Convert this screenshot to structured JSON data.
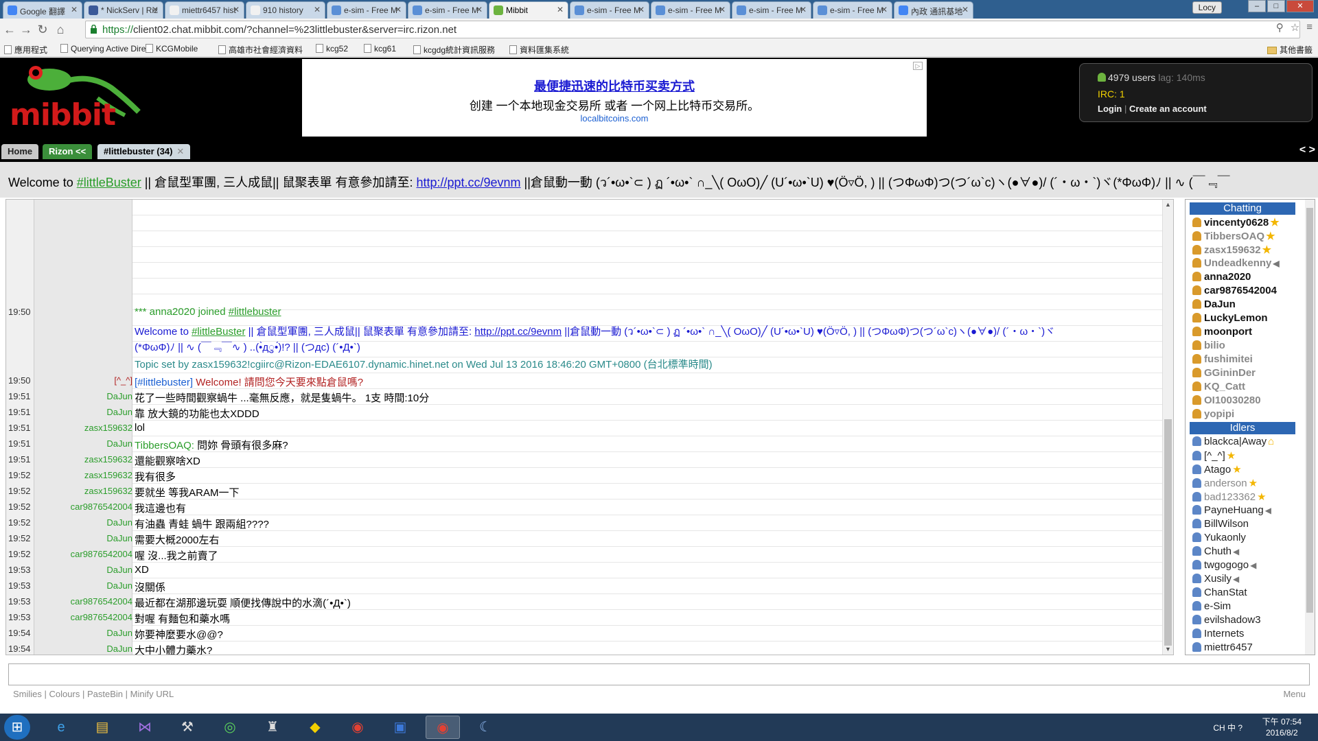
{
  "browser": {
    "tabs": [
      {
        "label": "Google 翻譯",
        "color": "#4285f4"
      },
      {
        "label": "* NickServ | Riz",
        "color": "#3b5998"
      },
      {
        "label": "miettr6457 hist",
        "color": "#f1f1f1"
      },
      {
        "label": "910 history",
        "color": "#f1f1f1"
      },
      {
        "label": "e-sim - Free M",
        "color": "#5a8fd6"
      },
      {
        "label": "e-sim - Free M",
        "color": "#5a8fd6"
      },
      {
        "label": "Mibbit",
        "color": "#6db33f"
      },
      {
        "label": "e-sim - Free M",
        "color": "#5a8fd6"
      },
      {
        "label": "e-sim - Free M",
        "color": "#5a8fd6"
      },
      {
        "label": "e-sim - Free M",
        "color": "#5a8fd6"
      },
      {
        "label": "e-sim - Free M",
        "color": "#5a8fd6"
      },
      {
        "label": "內政 通訊基地",
        "color": "#4285f4"
      }
    ],
    "profile": "Locy",
    "url_scheme": "https://",
    "url_rest": "client02.chat.mibbit.com/?channel=%23littlebuster&server=irc.rizon.net",
    "bookmarks": [
      {
        "label": "應用程式",
        "folder": false
      },
      {
        "label": "Querying Active Dire",
        "folder": false
      },
      {
        "label": "KCGMobile",
        "folder": false
      },
      {
        "label": "高雄市社會經濟資料",
        "folder": false
      },
      {
        "label": "kcg52",
        "folder": false
      },
      {
        "label": "kcg61",
        "folder": false
      },
      {
        "label": "kcgdg統計資訊服務",
        "folder": false
      },
      {
        "label": "資料匯集系統",
        "folder": false
      }
    ],
    "other_bookmarks": "其他書籤"
  },
  "mibbit": {
    "logo": "mibbit",
    "ad": {
      "title": "最便捷迅速的比特币买卖方式",
      "body": "创建 一个本地现金交易所 或者 一个网上比特币交易所。",
      "link": "localbitcoins.com"
    },
    "status": {
      "users": "4979 users",
      "lag": "lag: 140ms",
      "irc": "IRC: 1",
      "login": "Login",
      "sep": "|",
      "create": "Create an account"
    },
    "tabs": {
      "home": "Home",
      "server": "Rizon <<",
      "channel": "#littlebuster (34)",
      "arrows": "< >"
    },
    "topic": {
      "prefix": "Welcome to ",
      "channel_link": "#littleBuster",
      "mid": " || 倉鼠型軍團, 三人成鼠|| 鼠聚表單 有意參加請至: ",
      "url": "http://ppt.cc/9evnm",
      "tail": " ||倉鼠動一動 (ว´•ω•`⊂ ) ฏ ´•ω•` ∩_╲( OωO)╱ (U´•ω•`U) ♥(Ö▿Ö, ) || (つΦωΦ)つ(つ´ω`c)ヽ(●∀●)/ (´・ω・`)ヾ(*ΦωΦ)ﾉ || ∿ (￣﹃￣"
    },
    "system": {
      "join_time": "19:50",
      "join_text": "*** anna2020 joined ",
      "join_channel": "#littlebuster",
      "topic_line1_prefix": "Welcome to ",
      "topic_line1_channel": "#littleBuster",
      "topic_line1_mid": " || 倉鼠型軍團, 三人成鼠|| 鼠聚表單 有意參加請至: ",
      "topic_line1_url": "http://ppt.cc/9evnm",
      "topic_line1_tail": " ||倉鼠動一動 (ว´•ω•`⊂ ) ฏ ´•ω•` ∩_╲( OωO)╱ (U´•ω•`U) ♥(Ö▿Ö, ) || (つΦωΦ)つ(つ´ω`c)ヽ(●∀●)/ (´・ω・`)ヾ",
      "topic_line2": "(*ΦωΦ)ﾉ || ∿ (￣﹃￣∿ ) ..(•̀дु•́)!? || (つдc) (´•Д•`)",
      "set_by": "Topic set by zasx159632!cgiirc@Rizon-EDAE6107.dynamic.hinet.net on Wed Jul 13 2016 18:46:20 GMT+0800 (台北標準時間)"
    },
    "messages": [
      {
        "time": "19:50",
        "nick": "[^_^]",
        "op": true,
        "text": "Welcome! 請問您今天要來點倉鼠嗎?",
        "chan": "[#littlebuster]"
      },
      {
        "time": "19:51",
        "nick": "DaJun",
        "text": "花了一些時間觀察蝸牛 ...毫無反應，就是隻蝸牛。 1支 時間:10分"
      },
      {
        "time": "19:51",
        "nick": "DaJun",
        "text": "靠  放大鏡的功能也太XDDD"
      },
      {
        "time": "19:51",
        "nick": "zasx159632",
        "text": "lol"
      },
      {
        "time": "19:51",
        "nick": "DaJun",
        "text": "問妳  骨頭有很多麻?",
        "mention": "TibbersOAQ: "
      },
      {
        "time": "19:51",
        "nick": "zasx159632",
        "text": "還能觀察啥XD"
      },
      {
        "time": "19:52",
        "nick": "zasx159632",
        "text": "我有很多"
      },
      {
        "time": "19:52",
        "nick": "zasx159632",
        "text": "要就坐 等我ARAM一下"
      },
      {
        "time": "19:52",
        "nick": "car9876542004",
        "text": "我這邊也有"
      },
      {
        "time": "19:52",
        "nick": "DaJun",
        "text": "有油蟲 青蛙 蝸牛 跟兩組????"
      },
      {
        "time": "19:52",
        "nick": "DaJun",
        "text": "需要大概2000左右"
      },
      {
        "time": "19:52",
        "nick": "car9876542004",
        "text": "喔 沒...我之前賣了"
      },
      {
        "time": "19:53",
        "nick": "DaJun",
        "text": "XD"
      },
      {
        "time": "19:53",
        "nick": "DaJun",
        "text": "沒關係"
      },
      {
        "time": "19:53",
        "nick": "car9876542004",
        "text": "最近都在湖那邊玩耍 順便找傳說中的水滴(´•Д•`)"
      },
      {
        "time": "19:53",
        "nick": "car9876542004",
        "text": "對喔 有麵包和藥水嗎"
      },
      {
        "time": "19:54",
        "nick": "DaJun",
        "text": "妳要神麼要水@@?"
      },
      {
        "time": "19:54",
        "nick": "DaJun",
        "text": "大中小體力藥水?"
      }
    ],
    "userlist": {
      "chatting_label": "Chatting",
      "idlers_label": "Idlers",
      "chatting": [
        {
          "name": "vincenty0628",
          "badge": "star",
          "faded": false
        },
        {
          "name": "TibbersOAQ",
          "badge": "star",
          "faded": true
        },
        {
          "name": "zasx159632",
          "badge": "star",
          "faded": true
        },
        {
          "name": "Undeadkenny",
          "badge": "speaker",
          "faded": true
        },
        {
          "name": "anna2020",
          "badge": "",
          "faded": false
        },
        {
          "name": "car9876542004",
          "badge": "",
          "faded": false
        },
        {
          "name": "DaJun",
          "badge": "",
          "faded": false
        },
        {
          "name": "LuckyLemon",
          "badge": "",
          "faded": false
        },
        {
          "name": "moonport",
          "badge": "",
          "faded": false
        },
        {
          "name": "bilio",
          "badge": "",
          "faded": true
        },
        {
          "name": "fushimitei",
          "badge": "",
          "faded": true
        },
        {
          "name": "GGininDer",
          "badge": "",
          "faded": true
        },
        {
          "name": "KQ_Catt",
          "badge": "",
          "faded": true
        },
        {
          "name": "OI10030280",
          "badge": "",
          "faded": true
        },
        {
          "name": "yopipi",
          "badge": "",
          "faded": true
        }
      ],
      "idlers": [
        {
          "name": "blackca|Away",
          "badge": "home",
          "faded": false
        },
        {
          "name": "[^_^]",
          "badge": "star",
          "faded": false
        },
        {
          "name": "Atago",
          "badge": "star",
          "faded": false
        },
        {
          "name": "anderson",
          "badge": "star",
          "faded": true
        },
        {
          "name": "bad123362",
          "badge": "star",
          "faded": true
        },
        {
          "name": "PayneHuang",
          "badge": "speaker",
          "faded": false
        },
        {
          "name": "BillWilson",
          "badge": "",
          "faded": false
        },
        {
          "name": "Yukaonly",
          "badge": "",
          "faded": false
        },
        {
          "name": "Chuth",
          "badge": "speaker",
          "faded": false
        },
        {
          "name": "twgogogo",
          "badge": "speaker",
          "faded": false
        },
        {
          "name": "Xusily",
          "badge": "speaker",
          "faded": false
        },
        {
          "name": "ChanStat",
          "badge": "",
          "faded": false
        },
        {
          "name": "e-Sim",
          "badge": "",
          "faded": false
        },
        {
          "name": "evilshadow3",
          "badge": "",
          "faded": false
        },
        {
          "name": "Internets",
          "badge": "",
          "faded": false
        },
        {
          "name": "miettr6457",
          "badge": "",
          "faded": false
        }
      ]
    },
    "footer": {
      "smilies": "Smilies",
      "colours": "Colours",
      "pastebin": "PasteBin",
      "minify": "Minify URL",
      "sep": "|",
      "menu": "Menu"
    }
  },
  "taskbar": {
    "tray_text": "CH 中 ?",
    "time": "下午 07:54",
    "date": "2016/8/2"
  },
  "colors": {
    "accent_blue": "#2d67b3",
    "nick_green": "#2a9d2a",
    "brand_red": "#d21a1a",
    "chrome_blue": "#2f5f8f"
  }
}
